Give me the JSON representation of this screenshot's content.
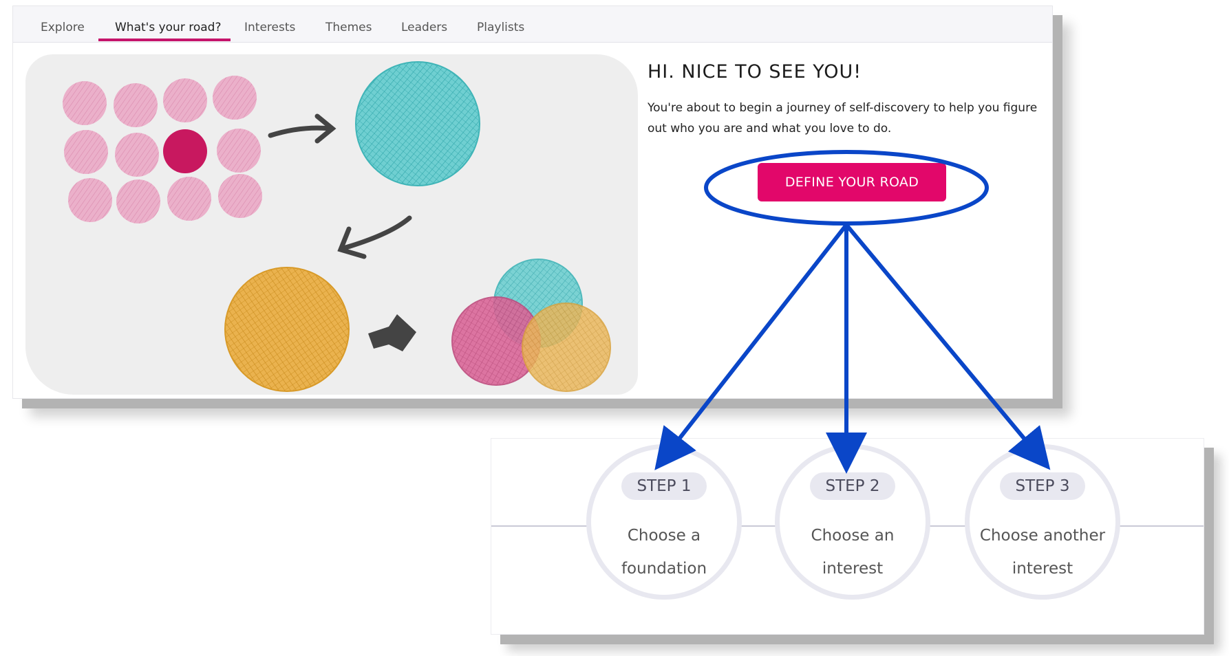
{
  "tabs": [
    {
      "label": "Explore",
      "active": false
    },
    {
      "label": "What's your road?",
      "active": true
    },
    {
      "label": "Interests",
      "active": false
    },
    {
      "label": "Themes",
      "active": false
    },
    {
      "label": "Leaders",
      "active": false
    },
    {
      "label": "Playlists",
      "active": false
    }
  ],
  "hero": {
    "greeting": "HI. NICE TO SEE YOU!",
    "intro": "You're about to begin a journey of self-discovery to help you figure out who you are and what you love to do.",
    "cta_label": "DEFINE YOUR ROAD"
  },
  "steps": [
    {
      "badge": "STEP 1",
      "line1": "Choose a",
      "line2": "foundation"
    },
    {
      "badge": "STEP 2",
      "line1": "Choose an",
      "line2": "interest"
    },
    {
      "badge": "STEP 3",
      "line1": "Choose another",
      "line2": "interest"
    }
  ],
  "colors": {
    "accent": "#e2076a",
    "tab_underline": "#c5146b",
    "annotation": "#0a46c8",
    "pink_dot": "#e8a5c3",
    "pink_dot_dark": "#c8185f",
    "teal": "#5cc6c9",
    "gold": "#e3a534",
    "magenta": "#d0457f"
  },
  "icons": [
    "arrow-right-icon",
    "arrow-down-left-icon",
    "arrow-forward-icon"
  ]
}
